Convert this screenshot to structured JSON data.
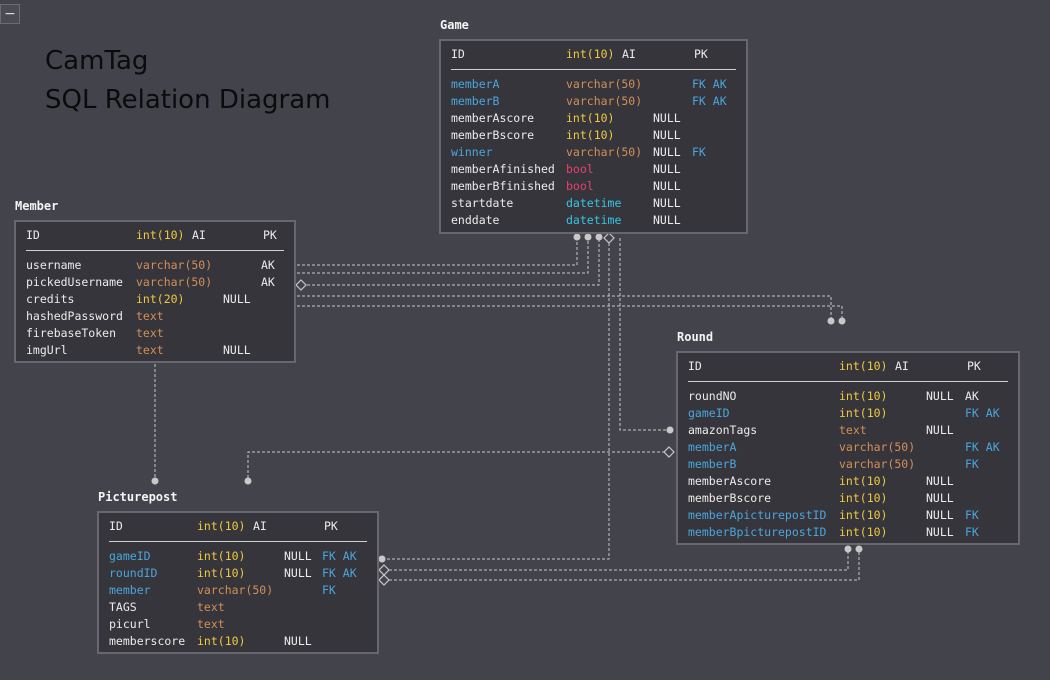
{
  "title_lines": [
    "CamTag",
    "SQL Relation Diagram"
  ],
  "collapse_symbol": "−",
  "colors": {
    "background": "#43434c",
    "table_bg": "#35353b",
    "table_border": "#67676f",
    "connector": "#c8c8c8",
    "white": "#ececec",
    "blue": "#4ba6de",
    "yellow": "#efca40",
    "orange": "#d48f58",
    "red": "#ea3f6d",
    "cyan": "#36c7e4"
  },
  "tables": {
    "game": {
      "name": "Game",
      "pk": {
        "name": "ID",
        "type": "int(10)",
        "extra": "AI",
        "key": "PK"
      },
      "columns": [
        {
          "name": "memberA",
          "type": "varchar(50)",
          "nullable": "",
          "key": "FK AK",
          "name_color": "blue",
          "type_color": "orange"
        },
        {
          "name": "memberB",
          "type": "varchar(50)",
          "nullable": "",
          "key": "FK AK",
          "name_color": "blue",
          "type_color": "orange"
        },
        {
          "name": "memberAscore",
          "type": "int(10)",
          "nullable": "NULL",
          "key": "",
          "name_color": "white",
          "type_color": "yellow"
        },
        {
          "name": "memberBscore",
          "type": "int(10)",
          "nullable": "NULL",
          "key": "",
          "name_color": "white",
          "type_color": "yellow"
        },
        {
          "name": "winner",
          "type": "varchar(50)",
          "nullable": "NULL",
          "key": "FK",
          "name_color": "blue",
          "type_color": "orange"
        },
        {
          "name": "memberAfinished",
          "type": "bool",
          "nullable": "NULL",
          "key": "",
          "name_color": "white",
          "type_color": "red"
        },
        {
          "name": "memberBfinished",
          "type": "bool",
          "nullable": "NULL",
          "key": "",
          "name_color": "white",
          "type_color": "red"
        },
        {
          "name": "startdate",
          "type": "datetime",
          "nullable": "NULL",
          "key": "",
          "name_color": "white",
          "type_color": "cyan"
        },
        {
          "name": "enddate",
          "type": "datetime",
          "nullable": "NULL",
          "key": "",
          "name_color": "white",
          "type_color": "cyan"
        }
      ]
    },
    "member": {
      "name": "Member",
      "pk": {
        "name": "ID",
        "type": "int(10)",
        "extra": "AI",
        "key": "PK"
      },
      "columns": [
        {
          "name": "username",
          "type": "varchar(50)",
          "nullable": "",
          "key": "AK",
          "name_color": "white",
          "type_color": "orange"
        },
        {
          "name": "pickedUsername",
          "type": "varchar(50)",
          "nullable": "",
          "key": "AK",
          "name_color": "white",
          "type_color": "orange"
        },
        {
          "name": "credits",
          "type": "int(20)",
          "nullable": "NULL",
          "key": "",
          "name_color": "white",
          "type_color": "yellow"
        },
        {
          "name": "hashedPassword",
          "type": "text",
          "nullable": "",
          "key": "",
          "name_color": "white",
          "type_color": "orange"
        },
        {
          "name": "firebaseToken",
          "type": "text",
          "nullable": "",
          "key": "",
          "name_color": "white",
          "type_color": "orange"
        },
        {
          "name": "imgUrl",
          "type": "text",
          "nullable": "NULL",
          "key": "",
          "name_color": "white",
          "type_color": "orange"
        }
      ]
    },
    "round": {
      "name": "Round",
      "pk": {
        "name": "ID",
        "type": "int(10)",
        "extra": "AI",
        "key": "PK"
      },
      "columns": [
        {
          "name": "roundNO",
          "type": "int(10)",
          "nullable": "NULL",
          "key": "AK",
          "name_color": "white",
          "type_color": "yellow"
        },
        {
          "name": "gameID",
          "type": "int(10)",
          "nullable": "",
          "key": "FK AK",
          "name_color": "blue",
          "type_color": "yellow"
        },
        {
          "name": "amazonTags",
          "type": "text",
          "nullable": "NULL",
          "key": "",
          "name_color": "white",
          "type_color": "orange"
        },
        {
          "name": "memberA",
          "type": "varchar(50)",
          "nullable": "",
          "key": "FK AK",
          "name_color": "blue",
          "type_color": "orange"
        },
        {
          "name": "memberB",
          "type": "varchar(50)",
          "nullable": "",
          "key": "FK",
          "name_color": "blue",
          "type_color": "orange"
        },
        {
          "name": "memberAscore",
          "type": "int(10)",
          "nullable": "NULL",
          "key": "",
          "name_color": "white",
          "type_color": "yellow"
        },
        {
          "name": "memberBscore",
          "type": "int(10)",
          "nullable": "NULL",
          "key": "",
          "name_color": "white",
          "type_color": "yellow"
        },
        {
          "name": "memberApicturepostID",
          "type": "int(10)",
          "nullable": "NULL",
          "key": "FK",
          "name_color": "blue",
          "type_color": "yellow"
        },
        {
          "name": "memberBpicturepostID",
          "type": "int(10)",
          "nullable": "NULL",
          "key": "FK",
          "name_color": "blue",
          "type_color": "yellow"
        }
      ]
    },
    "picturepost": {
      "name": "Picturepost",
      "pk": {
        "name": "ID",
        "type": "int(10)",
        "extra": "AI",
        "key": "PK"
      },
      "columns": [
        {
          "name": "gameID",
          "type": "int(10)",
          "nullable": "NULL",
          "key": "FK AK",
          "name_color": "blue",
          "type_color": "yellow"
        },
        {
          "name": "roundID",
          "type": "int(10)",
          "nullable": "NULL",
          "key": "FK AK",
          "name_color": "blue",
          "type_color": "yellow"
        },
        {
          "name": "member",
          "type": "varchar(50)",
          "nullable": "",
          "key": "FK",
          "name_color": "blue",
          "type_color": "orange"
        },
        {
          "name": "TAGS",
          "type": "text",
          "nullable": "",
          "key": "",
          "name_color": "white",
          "type_color": "orange"
        },
        {
          "name": "picurl",
          "type": "text",
          "nullable": "",
          "key": "",
          "name_color": "white",
          "type_color": "orange"
        },
        {
          "name": "memberscore",
          "type": "int(10)",
          "nullable": "NULL",
          "key": "",
          "name_color": "white",
          "type_color": "yellow"
        }
      ]
    }
  }
}
